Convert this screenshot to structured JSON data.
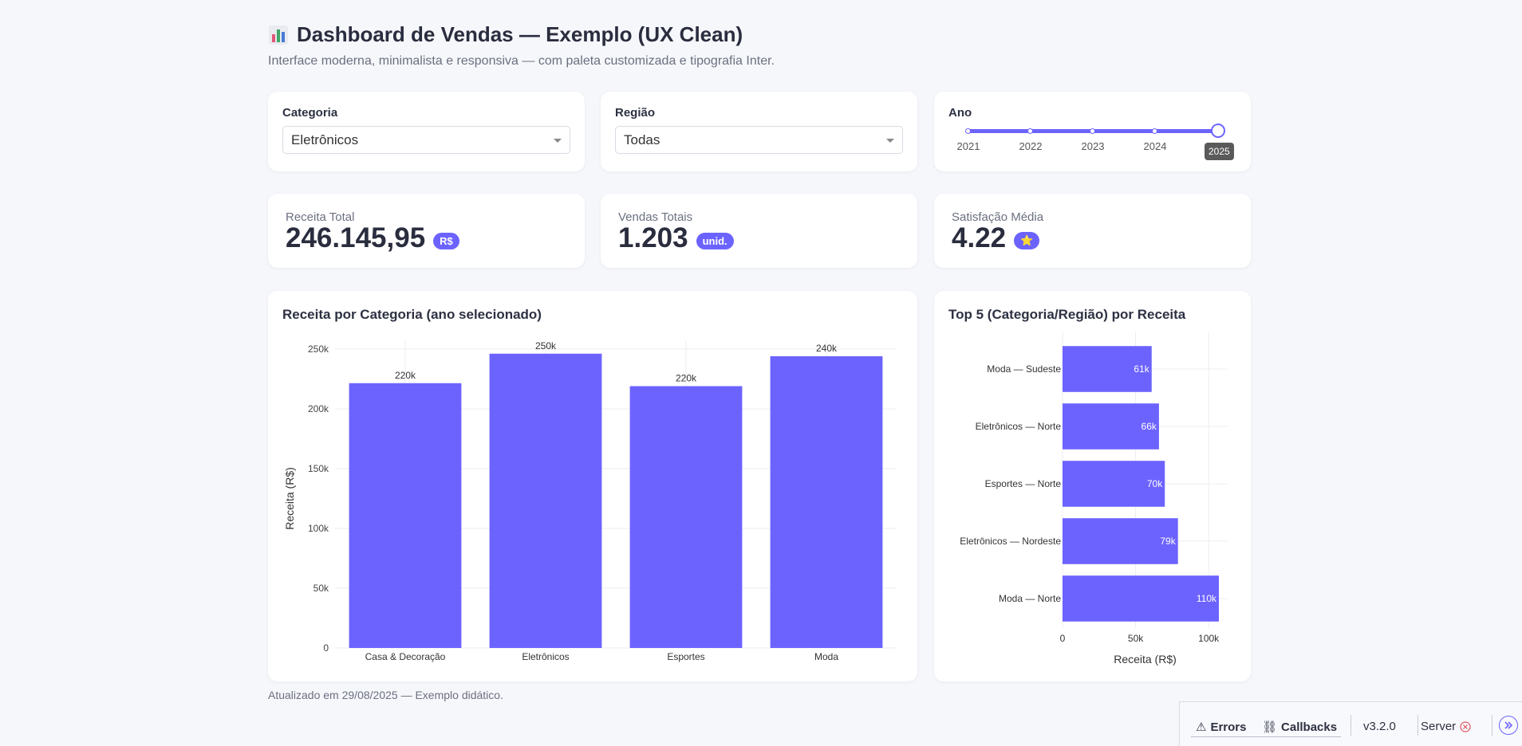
{
  "header": {
    "title": "Dashboard de Vendas — Exemplo (UX Clean)",
    "subtitle": "Interface moderna, minimalista e responsiva — com paleta customizada e tipografia Inter."
  },
  "filters": {
    "category": {
      "label": "Categoria",
      "value": "Eletrônicos"
    },
    "region": {
      "label": "Região",
      "value": "Todas"
    },
    "year": {
      "label": "Ano",
      "marks": [
        "2021",
        "2022",
        "2023",
        "2024",
        "2025"
      ],
      "selected": "2025"
    }
  },
  "kpis": {
    "revenue": {
      "label": "Receita Total",
      "value": "246.145,95",
      "badge": "R$"
    },
    "sales": {
      "label": "Vendas Totais",
      "value": "1.203",
      "badge": "unid."
    },
    "satisfaction": {
      "label": "Satisfação Média",
      "value": "4.22",
      "badge": "⭐"
    }
  },
  "colors": {
    "accent": "#6c63ff",
    "background": "#f6f7fb",
    "card": "#ffffff",
    "text": "#2d3142"
  },
  "chart_data": [
    {
      "type": "bar",
      "title": "Receita por Categoria (ano selecionado)",
      "categories": [
        "Casa & Decoração",
        "Eletrônicos",
        "Esportes",
        "Moda"
      ],
      "values": [
        221500,
        246146,
        219000,
        244000
      ],
      "data_labels": [
        "220k",
        "250k",
        "220k",
        "240k"
      ],
      "xlabel": "",
      "ylabel": "Receita (R$)",
      "ylim": [
        0,
        250000
      ],
      "yticks": [
        0,
        50000,
        100000,
        150000,
        200000,
        250000
      ],
      "ytick_labels": [
        "0",
        "50k",
        "100k",
        "150k",
        "200k",
        "250k"
      ],
      "grid": true
    },
    {
      "type": "bar",
      "orientation": "horizontal",
      "title": "Top 5 (Categoria/Região) por Receita",
      "categories": [
        "Moda — Sudeste",
        "Eletrônicos — Norte",
        "Esportes — Norte",
        "Eletrônicos — Nordeste",
        "Moda — Norte"
      ],
      "values": [
        61000,
        66000,
        70000,
        79000,
        107000
      ],
      "data_labels": [
        "61k",
        "66k",
        "70k",
        "79k",
        "110k"
      ],
      "xlabel": "Receita (R$)",
      "ylabel": "",
      "xlim": [
        0,
        113000
      ],
      "xticks": [
        0,
        50000,
        100000
      ],
      "xtick_labels": [
        "0",
        "50k",
        "100k"
      ],
      "grid": true
    }
  ],
  "footer": {
    "note": "Atualizado em 29/08/2025 — Exemplo didático."
  },
  "devtools": {
    "errors": "Errors",
    "callbacks": "Callbacks",
    "version": "v3.2.0",
    "server": "Server"
  }
}
